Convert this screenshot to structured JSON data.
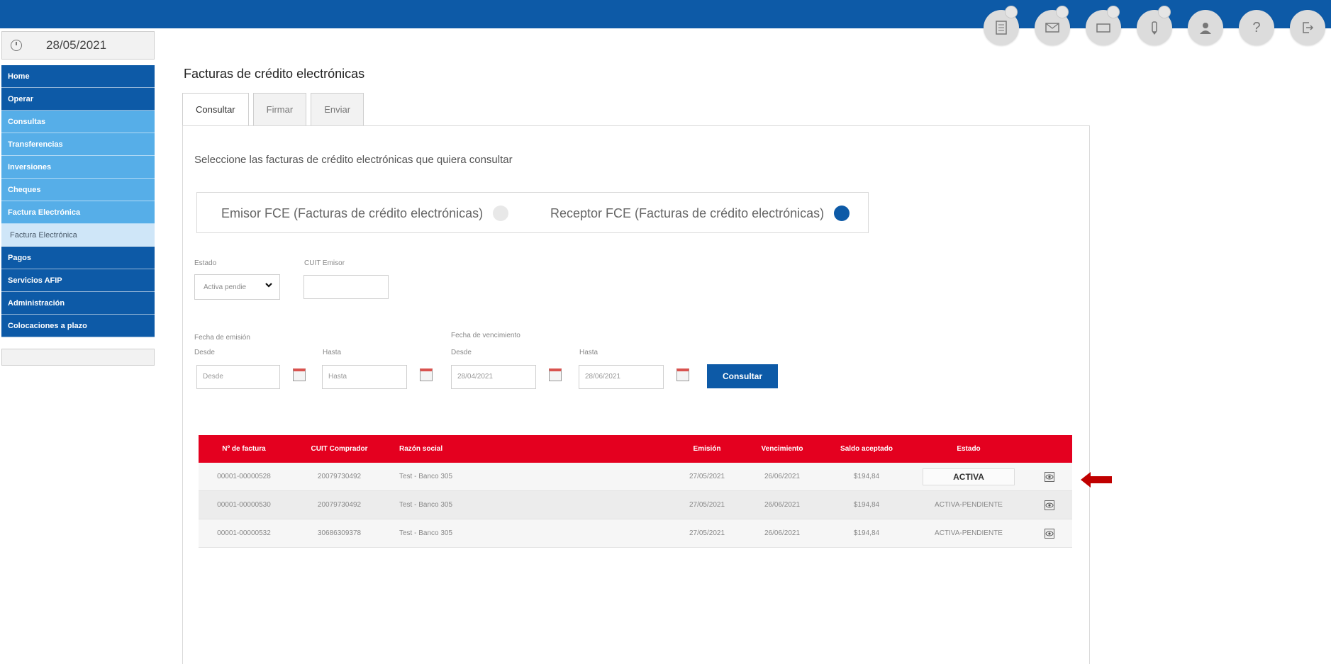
{
  "date": "28/05/2021",
  "sidebar": {
    "items": [
      {
        "label": "Home",
        "style": "dark"
      },
      {
        "label": "Operar",
        "style": "dark"
      },
      {
        "label": "Consultas",
        "style": "light"
      },
      {
        "label": "Transferencias",
        "style": "light"
      },
      {
        "label": "Inversiones",
        "style": "light"
      },
      {
        "label": "Cheques",
        "style": "light"
      },
      {
        "label": "Factura Electrónica",
        "style": "light"
      },
      {
        "label": "Factura Electrónica",
        "style": "sub"
      },
      {
        "label": "Pagos",
        "style": "dark"
      },
      {
        "label": "Servicios AFIP",
        "style": "dark"
      },
      {
        "label": "Administración",
        "style": "dark"
      },
      {
        "label": "Colocaciones a plazo",
        "style": "dark"
      }
    ]
  },
  "header_icons": [
    "document-icon",
    "mail-icon",
    "wallet-icon",
    "pen-icon",
    "user-icon",
    "help-icon",
    "logout-icon"
  ],
  "page_title": "Facturas de crédito electrónicas",
  "tabs": [
    {
      "label": "Consultar",
      "active": true
    },
    {
      "label": "Firmar",
      "active": false
    },
    {
      "label": "Enviar",
      "active": false
    }
  ],
  "instructions": "Seleccione las facturas de crédito electrónicas que quiera consultar",
  "roles": {
    "emisor": "Emisor FCE (Facturas de crédito electrónicas)",
    "receptor": "Receptor FCE (Facturas de crédito electrónicas)",
    "selected": "receptor"
  },
  "filters": {
    "estado_label": "Estado",
    "estado_value": "Activa pendie",
    "cuit_label": "CUIT Emisor",
    "cuit_value": "",
    "fecha_emision_label": "Fecha de emisión",
    "fecha_vencimiento_label": "Fecha de vencimiento",
    "desde_label": "Desde",
    "hasta_label": "Hasta",
    "emision_desde_placeholder": "Desde",
    "emision_hasta_placeholder": "Hasta",
    "venc_desde_value": "28/04/2021",
    "venc_hasta_value": "28/06/2021",
    "consultar_button": "Consultar"
  },
  "table": {
    "headers": [
      "Nº de factura",
      "CUIT Comprador",
      "Razón social",
      "Emisión",
      "Vencimiento",
      "Saldo aceptado",
      "Estado"
    ],
    "rows": [
      {
        "factura": "00001-00000528",
        "cuit": "20079730492",
        "razon": "Test - Banco 305",
        "emision": "27/05/2021",
        "vencimiento": "26/06/2021",
        "saldo": "$194,84",
        "estado": "ACTIVA"
      },
      {
        "factura": "00001-00000530",
        "cuit": "20079730492",
        "razon": "Test - Banco 305",
        "emision": "27/05/2021",
        "vencimiento": "26/06/2021",
        "saldo": "$194,84",
        "estado": "ACTIVA-PENDIENTE"
      },
      {
        "factura": "00001-00000532",
        "cuit": "30686309378",
        "razon": "Test - Banco 305",
        "emision": "27/05/2021",
        "vencimiento": "26/06/2021",
        "saldo": "$194,84",
        "estado": "ACTIVA-PENDIENTE"
      }
    ]
  },
  "colors": {
    "brand_blue": "#0d5aa7",
    "light_blue": "#56aee8",
    "table_header_red": "#e4001f",
    "arrow_red": "#c00000"
  }
}
